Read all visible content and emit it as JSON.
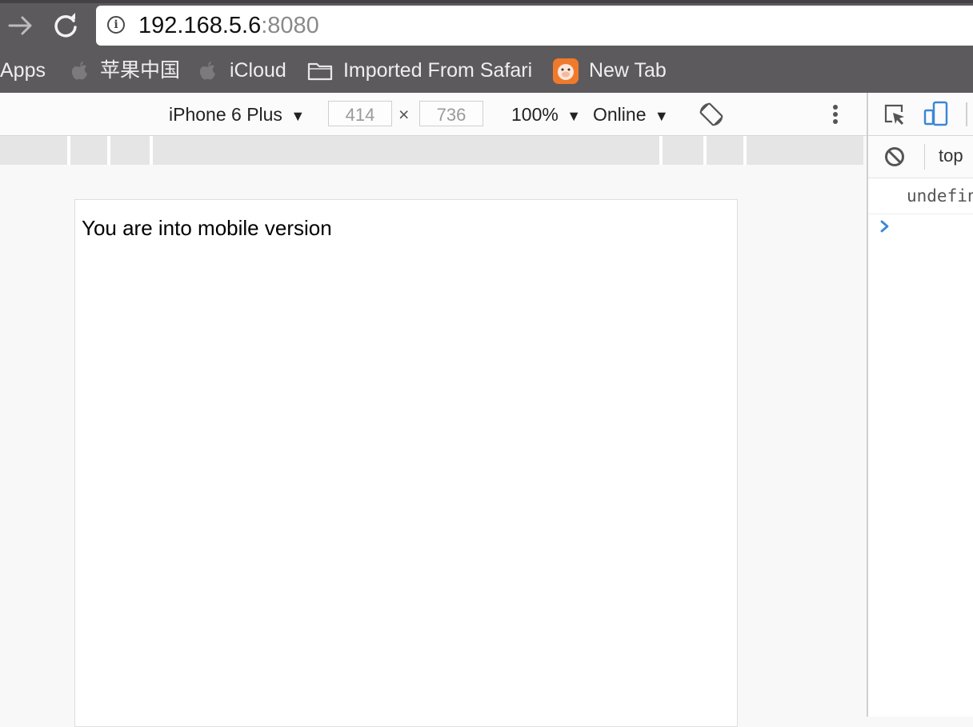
{
  "browser": {
    "nav": {
      "forward_icon": "arrow-right-icon",
      "reload_icon": "reload-icon"
    },
    "address_bar": {
      "host": "192.168.5.6",
      "port": ":8080",
      "icon": "info-icon"
    },
    "bookmarks": [
      {
        "label": "Apps",
        "icon": ""
      },
      {
        "label": "苹果中国",
        "icon": "apple-icon"
      },
      {
        "label": "iCloud",
        "icon": "apple-icon"
      },
      {
        "label": "Imported From Safari",
        "icon": "folder-icon"
      },
      {
        "label": "New Tab",
        "icon": "pig-face-icon"
      }
    ]
  },
  "device_toolbar": {
    "device": "iPhone 6 Plus",
    "width": "414",
    "times": "×",
    "height": "736",
    "zoom": "100%",
    "network": "Online"
  },
  "viewport": {
    "page_text": "You are into mobile version"
  },
  "side_panel": {
    "context": "top",
    "console_output": "undefin"
  },
  "colors": {
    "chrome_bg": "#5d5a5d",
    "accent_blue": "#3b87d6"
  }
}
